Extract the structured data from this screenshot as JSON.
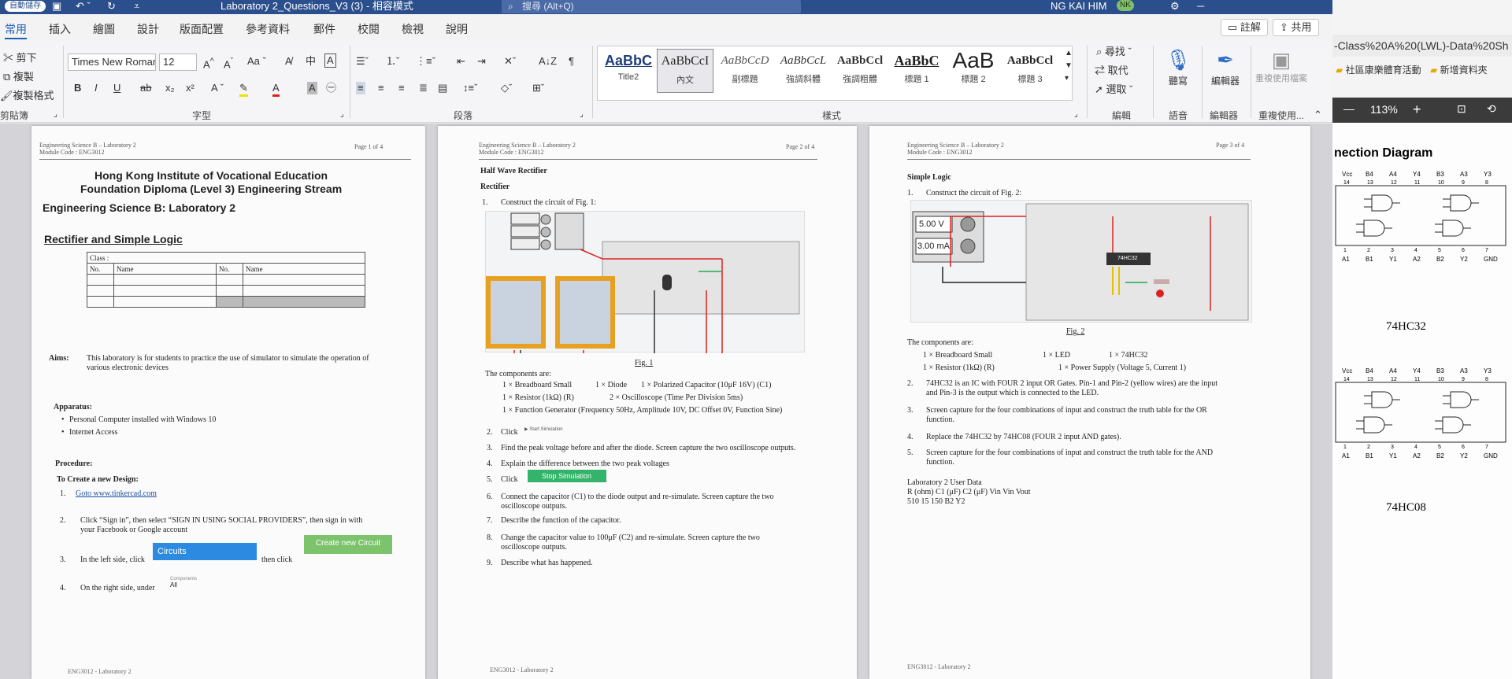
{
  "titlebar": {
    "autosave": "自動儲存",
    "doc_title": "Laboratory 2_Questions_V3 (3) - 相容模式",
    "search_placeholder": "搜尋 (Alt+Q)",
    "user_name": "NG KAI HIM",
    "user_initials": "NK"
  },
  "tabs": [
    "常用",
    "插入",
    "繪圖",
    "設計",
    "版面配置",
    "參考資料",
    "郵件",
    "校閱",
    "檢視",
    "說明"
  ],
  "tab_buttons": {
    "comments": "註解",
    "share": "共用"
  },
  "ribbon": {
    "clipboard": {
      "cut": "剪下",
      "copy": "複製",
      "format_painter": "複製格式",
      "label": "剪貼簿"
    },
    "font": {
      "name": "Times New Roman",
      "size": "12",
      "label": "字型",
      "bold": "B",
      "italic": "I",
      "underline": "U",
      "strike": "ab"
    },
    "paragraph": {
      "label": "段落"
    },
    "styles": {
      "label": "樣式",
      "items": [
        {
          "sample": "AaBbC",
          "name": "Title2"
        },
        {
          "sample": "AaBbCcI",
          "name": "內文"
        },
        {
          "sample": "AaBbCcD",
          "name": "副標題"
        },
        {
          "sample": "AaBbCcL",
          "name": "強調斜體"
        },
        {
          "sample": "AaBbCcl",
          "name": "強調粗體"
        },
        {
          "sample": "AaBbC",
          "name": "標題 1"
        },
        {
          "sample": "AaB",
          "name": "標題 2"
        },
        {
          "sample": "AaBbCcl",
          "name": "標題 3"
        }
      ]
    },
    "editing": {
      "find": "尋找",
      "replace": "取代",
      "select": "選取",
      "label": "編輯"
    },
    "voice": {
      "dictate": "聽寫",
      "label": "語音"
    },
    "editor": {
      "name": "編輯器",
      "label": "編輯器"
    },
    "reuse": {
      "name": "重複使用檔案",
      "label": "重複使用..."
    }
  },
  "page1": {
    "header_left1": "Engineering Science B – Laboratory 2",
    "header_left2": "Module Code : ENG3012",
    "header_right": "Page 1 of 4",
    "inst": "Hong Kong Institute of Vocational Education",
    "diploma": "Foundation Diploma (Level 3) Engineering Stream",
    "lab_title": "Engineering Science B: Laboratory 2",
    "subject": "Rectifier and Simple Logic",
    "table": {
      "class": "Class :",
      "no": "No.",
      "name": "Name"
    },
    "aims_label": "Aims:",
    "aims_1": "This laboratory is for students to practice the use of simulator to simulate the operation of",
    "aims_2": "various electronic devices",
    "apparatus_label": "Apparatus:",
    "app_1": "Personal Computer installed with Windows 10",
    "app_2": "Internet Access",
    "procedure_label": "Procedure:",
    "new_design": "To Create a new Design:",
    "step1": "Goto www.tinkercad.com",
    "step2a": "Click “Sign in”, then select “SIGN IN USING SOCIAL PROVIDERS”, then sign in with",
    "step2b": "your Facebook or Google account",
    "step3": "In the left side, click",
    "step3_btn": "Circuits",
    "step3_then": "then click",
    "step3_btn2": "Create new Circuit",
    "step4": "On the right side, under",
    "step4_label": "Components",
    "step4_val": "All",
    "footer": "ENG3012 - Laboratory 2"
  },
  "page2": {
    "header_left1": "Engineering Science B – Laboratory 2",
    "header_left2": "Module Code : ENG3012",
    "header_right": "Page 2 of 4",
    "section": "Half Wave Rectifier",
    "subsection": "Rectifier",
    "step1": "Construct the circuit of Fig. 1:",
    "fig": "Fig. 1",
    "components_label": "The components are:",
    "c1": "1 × Breadboard Small",
    "c2": "1 × Diode",
    "c3": "1 × Polarized Capacitor (10μF 16V) (C1)",
    "c4": "1 × Resistor (1kΩ) (R)",
    "c5": "2 × Oscilloscope (Time Per Division 5ms)",
    "c6": "1 × Function Generator (Frequency 50Hz, Amplitude 10V, DC Offset 0V, Function Sine)",
    "s2": "Click",
    "s2_btn": "Start Simulation",
    "s3": "Find the peak voltage before and after the diode.  Screen capture the two oscilloscope outputs.",
    "s4": "Explain the difference between the two peak voltages",
    "s5": "Click",
    "s5_btn": "Stop Simulation",
    "s6a": "Connect the capacitor (C1) to the diode output and re-simulate.  Screen capture the two",
    "s6b": "oscilloscope outputs.",
    "s7": "Describe the function of the capacitor.",
    "s8a": "Change the capacitor value to 100μF (C2) and re-simulate.  Screen capture the two",
    "s8b": "oscilloscope outputs.",
    "s9": "Describe what has happened.",
    "footer": "ENG3012 - Laboratory 2"
  },
  "page3": {
    "header_left1": "Engineering Science B – Laboratory 2",
    "header_left2": "Module Code : ENG3012",
    "header_right": "Page 3 of 4",
    "section": "Simple Logic",
    "step1": "Construct the circuit of Fig. 2:",
    "voltage": "5.00 V",
    "current": "3.00 mA",
    "chip": "74HC32",
    "fig": "Fig. 2",
    "components_label": "The components are:",
    "c1": "1 × Breadboard Small",
    "c2": "1 × LED",
    "c3": "1 × 74HC32",
    "c4": "1 × Resistor (1kΩ) (R)",
    "c5": "1 × Power Supply (Voltage 5, Current 1)",
    "s2a": "74HC32 is an IC with FOUR 2 input OR Gates.   Pin-1 and Pin-2 (yellow wires) are the input",
    "s2b": "and Pin-3 is the output which is connected to the LED.",
    "s3a": "Screen capture for the four combinations of input and construct the truth table for the OR",
    "s3b": "function.",
    "s4": "Replace the 74HC32 by 74HC08 (FOUR 2 input AND gates).",
    "s5a": "Screen capture for the four combinations of input and construct the truth table for the AND",
    "s5b": "function.",
    "data_title": "Laboratory 2 User Data",
    "data_head": "R (ohm) C1 (μF) C2 (μF) Vin Vin Vout",
    "data_vals": "510 15 150 B2 Y2",
    "footer": "ENG3012 - Laboratory 2"
  },
  "side": {
    "url": "-Class%20A%20(LWL)-Data%20Sh",
    "bookmark1": "社區康樂體育活動",
    "bookmark2": "新增資料夾",
    "zoom": "113%",
    "diagram_title": "nection Diagram",
    "chip1": "74HC32",
    "chip2": "74HC08",
    "pins_top": [
      "Vcc",
      "B4",
      "A4",
      "Y4",
      "B3",
      "A3",
      "Y3"
    ],
    "pins_top_num": [
      "14",
      "13",
      "12",
      "11",
      "10",
      "9",
      "8"
    ],
    "pins_bot": [
      "A1",
      "B1",
      "Y1",
      "A2",
      "B2",
      "Y2",
      "GND"
    ],
    "pins_bot_num": [
      "1",
      "2",
      "3",
      "4",
      "5",
      "6",
      "7"
    ]
  }
}
